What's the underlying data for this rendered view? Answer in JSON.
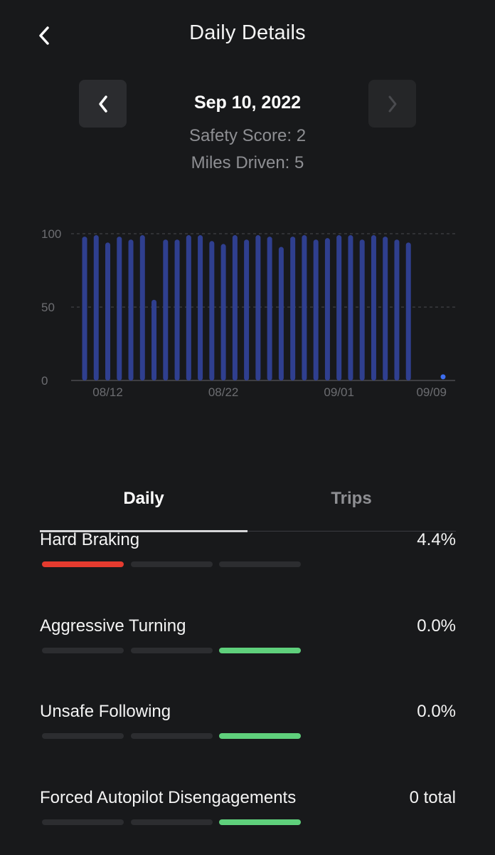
{
  "header": {
    "title": "Daily Details"
  },
  "date_nav": {
    "date": "Sep 10, 2022",
    "safety_score_text": "Safety Score: 2",
    "miles_driven_text": "Miles Driven: 5"
  },
  "chart_data": {
    "type": "bar",
    "title": "",
    "xlabel": "",
    "ylabel": "",
    "ylim": [
      0,
      100
    ],
    "yticks": [
      0,
      50,
      100
    ],
    "grid": "dashed at 50 and 100",
    "x_tick_labels": [
      "08/12",
      "08/22",
      "09/01",
      "09/09"
    ],
    "x": [
      "08/10",
      "08/11",
      "08/12",
      "08/13",
      "08/14",
      "08/15",
      "08/16",
      "08/17",
      "08/18",
      "08/19",
      "08/20",
      "08/21",
      "08/22",
      "08/23",
      "08/24",
      "08/25",
      "08/26",
      "08/27",
      "08/28",
      "08/29",
      "08/30",
      "08/31",
      "09/01",
      "09/02",
      "09/03",
      "09/04",
      "09/05",
      "09/06",
      "09/07",
      "09/08",
      "09/09",
      "09/10"
    ],
    "values": [
      98,
      99,
      94,
      98,
      96,
      99,
      55,
      96,
      96,
      99,
      99,
      95,
      93,
      99,
      96,
      99,
      98,
      91,
      98,
      99,
      96,
      97,
      99,
      99,
      96,
      99,
      98,
      96,
      94,
      null,
      null,
      2
    ],
    "colors": {
      "bar": "#2f3f8f",
      "highlight": "#3d6ef0",
      "grid": "#4a4b4f",
      "axis_text": "#6c6d71"
    }
  },
  "tabs": [
    {
      "label": "Daily",
      "active": true
    },
    {
      "label": "Trips",
      "active": false
    }
  ],
  "metrics": [
    {
      "name": "Hard Braking",
      "value": "4.4%",
      "level": 1,
      "level_color": "#e53b2f"
    },
    {
      "name": "Aggressive Turning",
      "value": "0.0%",
      "level": 3,
      "level_color": "#5fd07c"
    },
    {
      "name": "Unsafe Following",
      "value": "0.0%",
      "level": 3,
      "level_color": "#5fd07c"
    },
    {
      "name": "Forced Autopilot Disengagements",
      "value": "0 total",
      "level": 3,
      "level_color": "#5fd07c"
    }
  ]
}
